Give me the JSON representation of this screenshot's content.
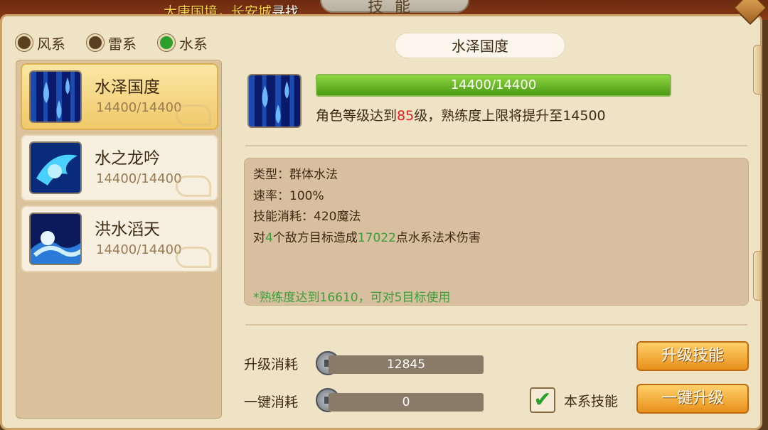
{
  "header": {
    "quest_prefix": "大唐国境，长安城",
    "quest_action": "寻找",
    "window_title": "技能"
  },
  "element_tabs": [
    {
      "label": "风系",
      "selected": false
    },
    {
      "label": "雷系",
      "selected": false
    },
    {
      "label": "水系",
      "selected": true
    }
  ],
  "skills": [
    {
      "name": "水泽国度",
      "progress": "14400/14400",
      "icon": "rain-drops-icon"
    },
    {
      "name": "水之龙吟",
      "progress": "14400/14400",
      "icon": "water-dragon-icon"
    },
    {
      "name": "洪水滔天",
      "progress": "14400/14400",
      "icon": "flood-wave-icon"
    }
  ],
  "detail": {
    "name": "水泽国度",
    "progress_text": "14400/14400",
    "progress_fraction": 1.0,
    "hint_before": "角色等级达到",
    "hint_level": "85",
    "hint_after": "级，熟练度上限将提升至14500",
    "type_line": "类型：群体水法",
    "speed_line": "速率：100%",
    "cost_line": "技能消耗：420魔法",
    "damage_pre": "对",
    "damage_targets": "4",
    "damage_mid": "个敌方目标造成",
    "damage_value": "17022",
    "damage_post": "点水系法术伤害",
    "note": "*熟练度达到16610，可对5目标使用"
  },
  "costs": {
    "upgrade_label": "升级消耗",
    "upgrade_value": "12845",
    "onekey_label": "一键消耗",
    "onekey_value": "0"
  },
  "buttons": {
    "upgrade": "升级技能",
    "onekey_upgrade": "一键升级"
  },
  "checkbox": {
    "label": "本系技能",
    "checked": true
  },
  "colors": {
    "accent_green": "#2aa02a",
    "highlight_red": "#e02020",
    "button_orange": "#e8901a"
  }
}
